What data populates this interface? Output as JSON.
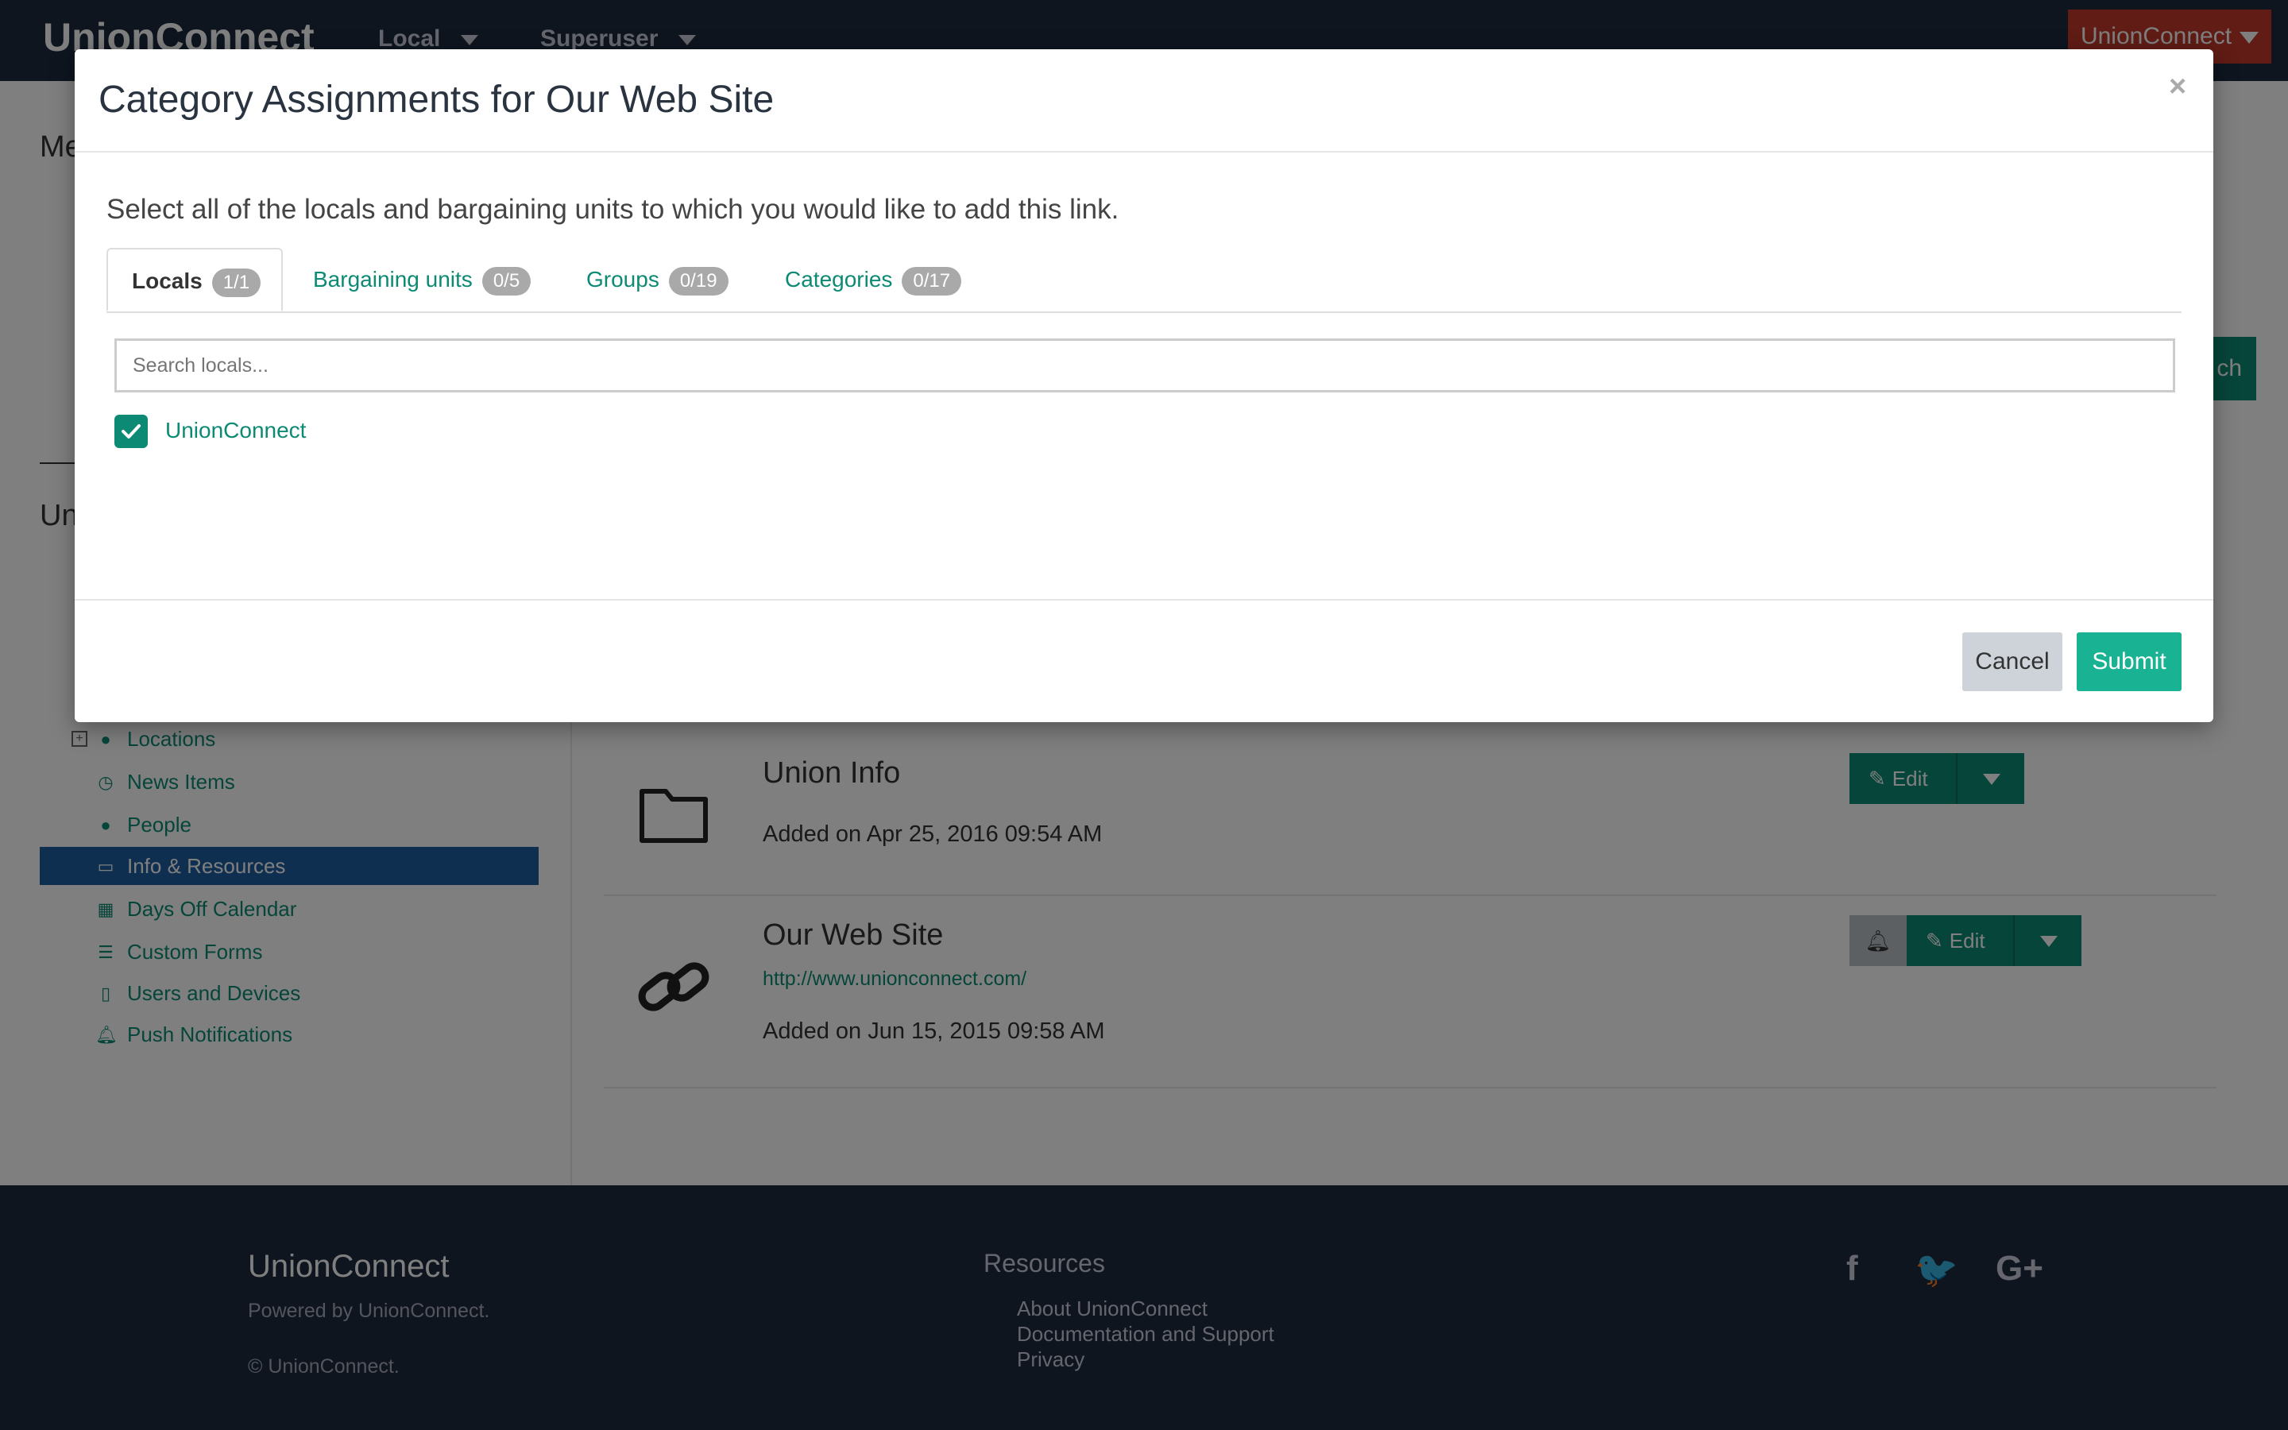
{
  "app": {
    "brand": "UnionConnect",
    "nav": [
      {
        "label": "Local"
      },
      {
        "label": "Superuser"
      }
    ],
    "user_button": "UnionConnect"
  },
  "sidebar": {
    "heading1": "Me",
    "heading2": "Un",
    "items": [
      {
        "label": "Locations",
        "icon": "globe-icon"
      },
      {
        "label": "News Items",
        "icon": "clock-icon"
      },
      {
        "label": "People",
        "icon": "person-icon"
      },
      {
        "label": "Info & Resources",
        "icon": "folder-open-icon",
        "active": true
      },
      {
        "label": "Days Off Calendar",
        "icon": "calendar-icon"
      },
      {
        "label": "Custom Forms",
        "icon": "list-icon"
      },
      {
        "label": "Users and Devices",
        "icon": "tablet-icon"
      },
      {
        "label": "Push Notifications",
        "icon": "bell-icon"
      }
    ]
  },
  "main": {
    "search_button_partial": "ch",
    "rows": [
      {
        "title": "Union Info",
        "date": "Added on Apr 25, 2016 09:54 AM",
        "icon": "folder-icon",
        "edit_label": "Edit"
      },
      {
        "title": "Our Web Site",
        "link": "http://www.unionconnect.com/",
        "date": "Added on Jun 15, 2015 09:58 AM",
        "icon": "link-icon",
        "edit_label": "Edit"
      }
    ]
  },
  "footer": {
    "brand": "UnionConnect",
    "powered": "Powered by UnionConnect.",
    "copyright": "© UnionConnect.",
    "resources_heading": "Resources",
    "links": [
      "About UnionConnect",
      "Documentation and Support",
      "Privacy"
    ],
    "social": [
      {
        "glyph": "f",
        "icon": "facebook-icon"
      },
      {
        "glyph": "🐦",
        "icon": "twitter-icon"
      },
      {
        "glyph": "G+",
        "icon": "google-plus-icon"
      }
    ]
  },
  "modal": {
    "title": "Category Assignments for Our Web Site",
    "close": "×",
    "instructions": "Select all of the locals and bargaining units to which you would like to add this link.",
    "tabs": [
      {
        "label": "Locals",
        "count": "1/1"
      },
      {
        "label": "Bargaining units",
        "count": "0/5"
      },
      {
        "label": "Groups",
        "count": "0/19"
      },
      {
        "label": "Categories",
        "count": "0/17"
      }
    ],
    "search_placeholder": "Search locals...",
    "items": [
      {
        "label": "UnionConnect",
        "checked": true
      }
    ],
    "cancel": "Cancel",
    "submit": "Submit"
  },
  "colors": {
    "accent": "#0d8a74",
    "submit": "#19b394",
    "navbar": "#1c2b3f",
    "user_button": "#c0392b",
    "active_nav": "#1e5fa3"
  }
}
